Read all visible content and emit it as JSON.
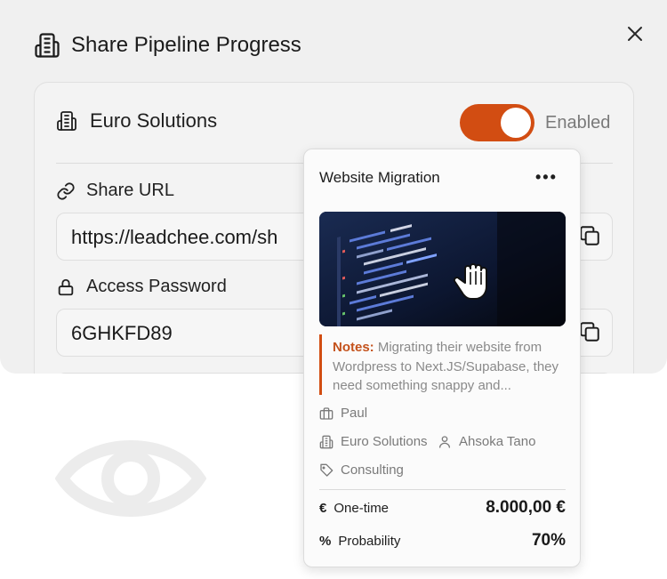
{
  "modal": {
    "title": "Share Pipeline Progress",
    "company": "Euro Solutions",
    "toggle_label": "Enabled",
    "share_url_label": "Share URL",
    "share_url_value": "https://leadchee.com/sh",
    "password_label": "Access Password",
    "password_value": "6GHKFD89"
  },
  "card": {
    "title": "Website Migration",
    "notes_label": "Notes:",
    "notes_text": "Migrating their website from Wordpress to Next.JS/Supabase, they need something snappy and...",
    "owner": "Paul",
    "company": "Euro Solutions",
    "contact": "Ahsoka Tano",
    "category": "Consulting",
    "one_time_label": "One-time",
    "one_time_value": "8.000,00 €",
    "probability_label": "Probability",
    "probability_value": "70%"
  },
  "colors": {
    "accent": "#d24d12",
    "modal_bg": "#f0f0f0"
  }
}
